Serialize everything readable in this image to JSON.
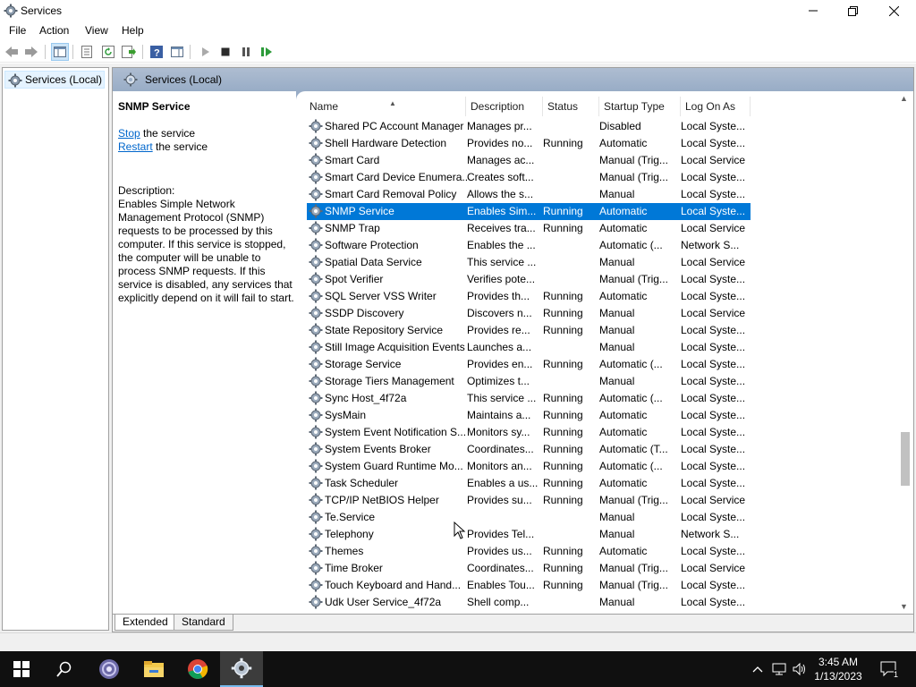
{
  "window": {
    "title": "Services"
  },
  "menu": [
    "File",
    "Action",
    "View",
    "Help"
  ],
  "tree": {
    "root_label": "Services (Local)"
  },
  "content_header": {
    "title": "Services (Local)"
  },
  "extended": {
    "service_name": "SNMP Service",
    "stop_link": "Stop",
    "stop_suffix": " the service",
    "restart_link": "Restart",
    "restart_suffix": " the service",
    "description": "Description:\nEnables Simple Network Management Protocol (SNMP) requests to be processed by this computer. If this service is stopped, the computer will be unable to process SNMP requests. If this service is disabled, any services that explicitly depend on it will fail to start."
  },
  "columns": [
    "Name",
    "Description",
    "Status",
    "Startup Type",
    "Log On As"
  ],
  "rows": [
    {
      "name": "Shared PC Account Manager",
      "desc": "Manages pr...",
      "status": "",
      "startup": "Disabled",
      "logon": "Local Syste..."
    },
    {
      "name": "Shell Hardware Detection",
      "desc": "Provides no...",
      "status": "Running",
      "startup": "Automatic",
      "logon": "Local Syste..."
    },
    {
      "name": "Smart Card",
      "desc": "Manages ac...",
      "status": "",
      "startup": "Manual (Trig...",
      "logon": "Local Service"
    },
    {
      "name": "Smart Card Device Enumera...",
      "desc": "Creates soft...",
      "status": "",
      "startup": "Manual (Trig...",
      "logon": "Local Syste..."
    },
    {
      "name": "Smart Card Removal Policy",
      "desc": "Allows the s...",
      "status": "",
      "startup": "Manual",
      "logon": "Local Syste..."
    },
    {
      "name": "SNMP Service",
      "desc": "Enables Sim...",
      "status": "Running",
      "startup": "Automatic",
      "logon": "Local Syste...",
      "selected": true
    },
    {
      "name": "SNMP Trap",
      "desc": "Receives tra...",
      "status": "Running",
      "startup": "Automatic",
      "logon": "Local Service"
    },
    {
      "name": "Software Protection",
      "desc": "Enables the ...",
      "status": "",
      "startup": "Automatic (...",
      "logon": "Network S..."
    },
    {
      "name": "Spatial Data Service",
      "desc": "This service ...",
      "status": "",
      "startup": "Manual",
      "logon": "Local Service"
    },
    {
      "name": "Spot Verifier",
      "desc": "Verifies pote...",
      "status": "",
      "startup": "Manual (Trig...",
      "logon": "Local Syste..."
    },
    {
      "name": "SQL Server VSS Writer",
      "desc": "Provides th...",
      "status": "Running",
      "startup": "Automatic",
      "logon": "Local Syste..."
    },
    {
      "name": "SSDP Discovery",
      "desc": "Discovers n...",
      "status": "Running",
      "startup": "Manual",
      "logon": "Local Service"
    },
    {
      "name": "State Repository Service",
      "desc": "Provides re...",
      "status": "Running",
      "startup": "Manual",
      "logon": "Local Syste..."
    },
    {
      "name": "Still Image Acquisition Events",
      "desc": "Launches a...",
      "status": "",
      "startup": "Manual",
      "logon": "Local Syste..."
    },
    {
      "name": "Storage Service",
      "desc": "Provides en...",
      "status": "Running",
      "startup": "Automatic (...",
      "logon": "Local Syste..."
    },
    {
      "name": "Storage Tiers Management",
      "desc": "Optimizes t...",
      "status": "",
      "startup": "Manual",
      "logon": "Local Syste..."
    },
    {
      "name": "Sync Host_4f72a",
      "desc": "This service ...",
      "status": "Running",
      "startup": "Automatic (...",
      "logon": "Local Syste..."
    },
    {
      "name": "SysMain",
      "desc": "Maintains a...",
      "status": "Running",
      "startup": "Automatic",
      "logon": "Local Syste..."
    },
    {
      "name": "System Event Notification S...",
      "desc": "Monitors sy...",
      "status": "Running",
      "startup": "Automatic",
      "logon": "Local Syste..."
    },
    {
      "name": "System Events Broker",
      "desc": "Coordinates...",
      "status": "Running",
      "startup": "Automatic (T...",
      "logon": "Local Syste..."
    },
    {
      "name": "System Guard Runtime Mo...",
      "desc": "Monitors an...",
      "status": "Running",
      "startup": "Automatic (...",
      "logon": "Local Syste..."
    },
    {
      "name": "Task Scheduler",
      "desc": "Enables a us...",
      "status": "Running",
      "startup": "Automatic",
      "logon": "Local Syste..."
    },
    {
      "name": "TCP/IP NetBIOS Helper",
      "desc": "Provides su...",
      "status": "Running",
      "startup": "Manual (Trig...",
      "logon": "Local Service"
    },
    {
      "name": "Te.Service",
      "desc": "",
      "status": "",
      "startup": "Manual",
      "logon": "Local Syste..."
    },
    {
      "name": "Telephony",
      "desc": "Provides Tel...",
      "status": "",
      "startup": "Manual",
      "logon": "Network S..."
    },
    {
      "name": "Themes",
      "desc": "Provides us...",
      "status": "Running",
      "startup": "Automatic",
      "logon": "Local Syste..."
    },
    {
      "name": "Time Broker",
      "desc": "Coordinates...",
      "status": "Running",
      "startup": "Manual (Trig...",
      "logon": "Local Service"
    },
    {
      "name": "Touch Keyboard and Hand...",
      "desc": "Enables Tou...",
      "status": "Running",
      "startup": "Manual (Trig...",
      "logon": "Local Syste..."
    },
    {
      "name": "Udk User Service_4f72a",
      "desc": "Shell comp...",
      "status": "",
      "startup": "Manual",
      "logon": "Local Syste..."
    }
  ],
  "tabs": {
    "extended": "Extended",
    "standard": "Standard"
  },
  "clock": {
    "time": "3:45 AM",
    "date": "1/13/2023"
  },
  "notification_count": "1",
  "colors": {
    "selection": "#0078d7",
    "header_band": "#98acc6",
    "taskbar": "#101010"
  }
}
